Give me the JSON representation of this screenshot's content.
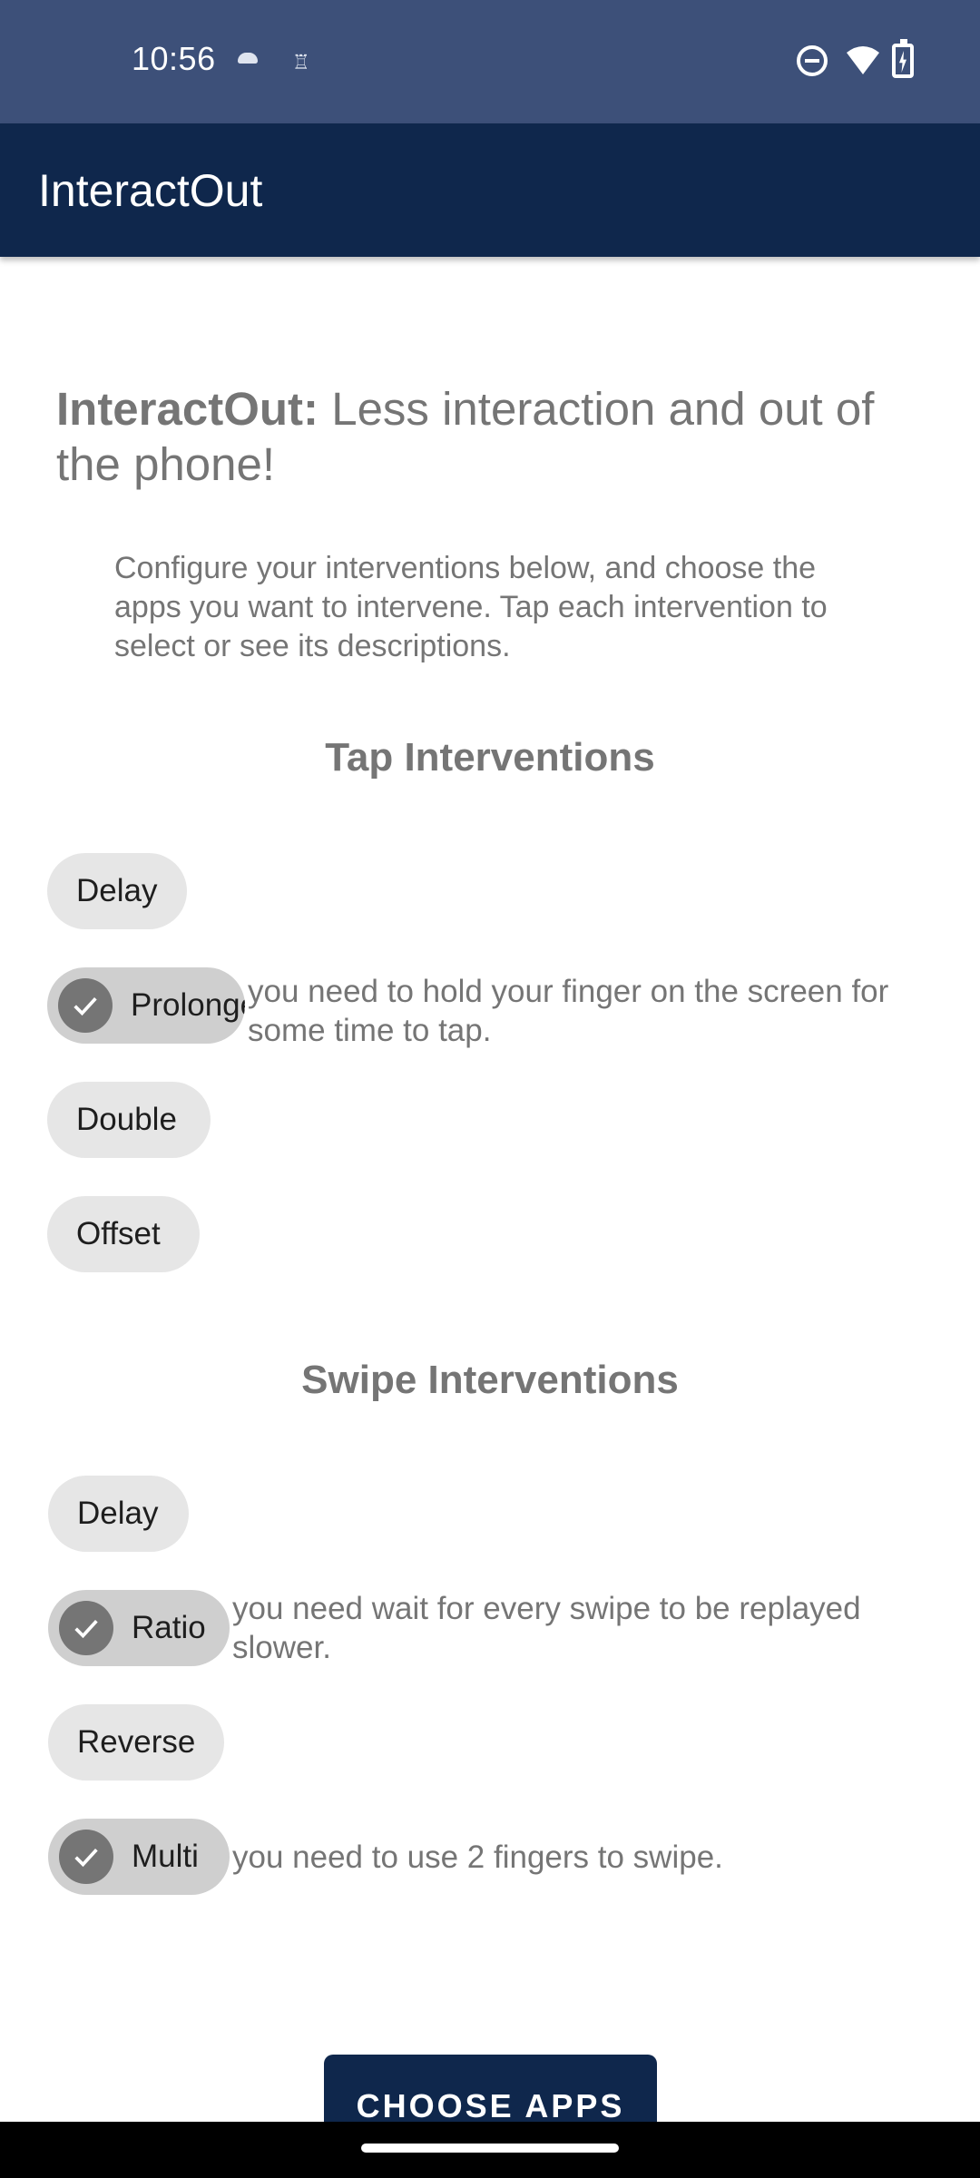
{
  "status_bar": {
    "time": "10:56",
    "icons": [
      "cloud-icon",
      "chess-icon",
      "do-not-disturb-icon",
      "wifi-icon",
      "battery-charging-icon"
    ]
  },
  "app_bar": {
    "title": "InteractOut"
  },
  "headline": {
    "bold": "InteractOut:",
    "rest": " Less interaction and out of the phone!"
  },
  "intro": "Configure your interventions below, and choose the apps you want to intervene. Tap each intervention to select or see its descriptions.",
  "tap_section": {
    "title": "Tap Interventions",
    "chips": [
      {
        "label": "Delay",
        "selected": false
      },
      {
        "label": "Prolonged",
        "selected": true,
        "description": "you need to hold your finger on the screen for some time to tap."
      },
      {
        "label": "Double",
        "selected": false
      },
      {
        "label": "Offset",
        "selected": false
      }
    ]
  },
  "swipe_section": {
    "title": "Swipe Interventions",
    "chips": [
      {
        "label": "Delay",
        "selected": false
      },
      {
        "label": "Ratio",
        "selected": true,
        "description": "you need wait for every swipe to be replayed slower."
      },
      {
        "label": "Reverse",
        "selected": false
      },
      {
        "label": "Multi",
        "selected": true,
        "description": "you need to use 2 fingers to swipe."
      }
    ]
  },
  "choose_button": {
    "label": "CHOOSE APPS"
  },
  "colors": {
    "primary": "#0f274c",
    "status_bar": "#3d5079",
    "chip": "#e6e6e6",
    "chip_selected": "#cfcfcf",
    "text_gray": "#757575"
  }
}
